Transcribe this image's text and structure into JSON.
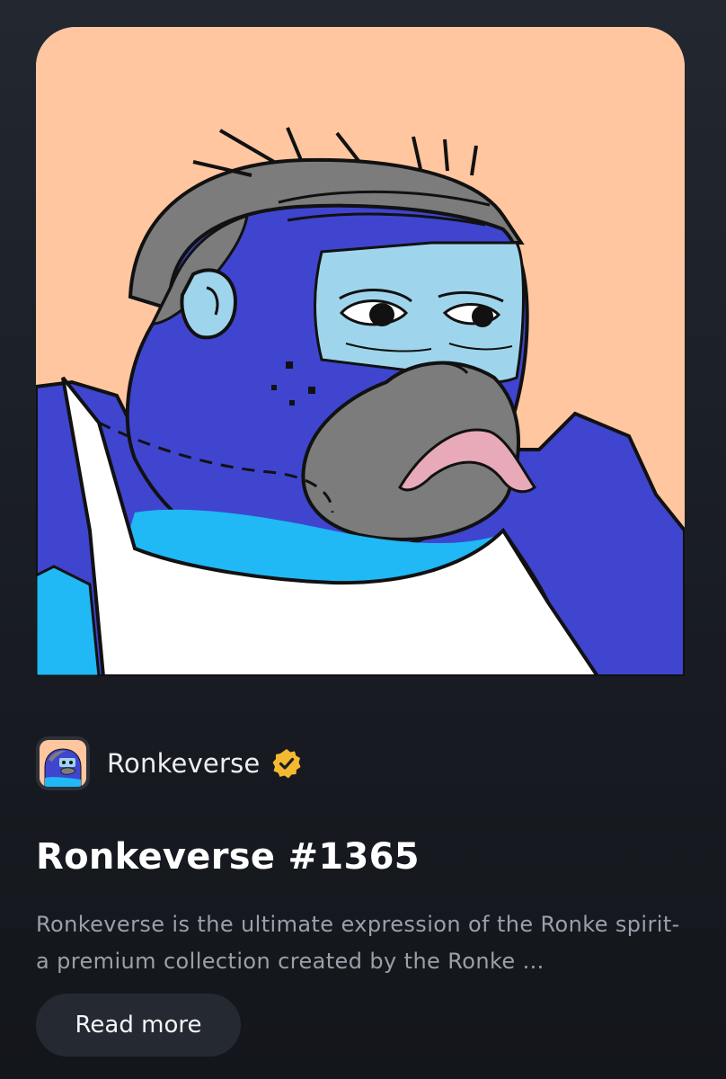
{
  "nft": {
    "image_icon": "gorilla-artwork",
    "background_color": "#ffc6a0",
    "collection": {
      "avatar_icon": "collection-avatar-icon",
      "name": "Ronkeverse",
      "verified_icon": "verified-badge-icon",
      "badge_color": "#f5b931"
    },
    "title": "Ronkeverse #1365",
    "description": "Ronkeverse is the ultimate expression of the Ronke spirit-a premium collection created by the Ronke ...",
    "read_more_label": "Read more"
  }
}
